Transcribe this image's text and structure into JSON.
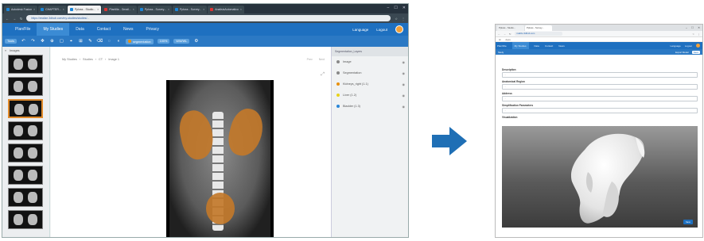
{
  "colors": {
    "brand": "#1e70c0",
    "brand_dark": "#2b79c4",
    "accent_orange": "#e8900f",
    "segmentation": "#c2782a",
    "arrow": "#1f6fb5"
  },
  "left_window": {
    "tabs": [
      {
        "label": "Autodesk Fusion",
        "active": false
      },
      {
        "label": "CHAPTER...",
        "active": false
      },
      {
        "label": "Ppluss - Studio...",
        "active": true
      },
      {
        "label": "Plantilla - Gmail...",
        "active": false
      },
      {
        "label": "Ppluss - Survey...",
        "active": false
      },
      {
        "label": "Ppluss - Survey...",
        "active": false
      },
      {
        "label": "AnalisisAutomatico",
        "active": false
      }
    ],
    "url": "https://realize.3dhub.com/my-studies/studies/...",
    "nav": {
      "items": [
        {
          "label": "Plan/File",
          "active": false
        },
        {
          "label": "My Studies",
          "active": true
        },
        {
          "label": "Data",
          "active": false
        },
        {
          "label": "Contact",
          "active": false
        },
        {
          "label": "News",
          "active": false
        },
        {
          "label": "Privacy",
          "active": false
        }
      ],
      "language": "Language",
      "logout": "Logout"
    },
    "toolbar": {
      "tool_label": "Tools",
      "layer_chip": "segmentation",
      "zoom_chip": "100%",
      "wl_chip": "WW/WL"
    },
    "thumbnails": {
      "header": "Images",
      "count": 8,
      "selected_index": 2
    },
    "viewer": {
      "breadcrumb": [
        "My Studies",
        "Studies",
        "CT",
        "Image 1"
      ],
      "tools": [
        "Prev",
        "Next"
      ]
    },
    "right_panel": {
      "header": "Segmentation_Layers",
      "layers": [
        {
          "label": "Image",
          "color": "#888888"
        },
        {
          "label": "Segmentation",
          "color": "#888888"
        },
        {
          "label": "Kidneys_right (1.1)",
          "color": "#e8900f"
        },
        {
          "label": "Liver (1.2)",
          "color": "#e8d21a"
        },
        {
          "label": "Bladder (1.3)",
          "color": "#2a86d8"
        }
      ]
    }
  },
  "right_window": {
    "tabs": [
      {
        "label": "Ppluss - Studio...",
        "active": false
      },
      {
        "label": "Ppluss - Survey...",
        "active": true
      }
    ],
    "url": "realize.3dhub.com",
    "bookmark": "Apps",
    "nav": {
      "items": [
        {
          "label": "Plan/File",
          "active": false
        },
        {
          "label": "My Studies",
          "active": true
        },
        {
          "label": "Data",
          "active": false
        },
        {
          "label": "Contact",
          "active": false
        },
        {
          "label": "News",
          "active": false
        }
      ],
      "language": "Language",
      "logout": "Logout"
    },
    "subbar": {
      "title": "Study",
      "buttons": [
        "Export Model",
        "Save"
      ]
    },
    "form": {
      "fields": [
        {
          "label": "Description",
          "value": "..."
        },
        {
          "label": "Anatomical Region",
          "value": "..."
        },
        {
          "label": "Address",
          "value": "..."
        },
        {
          "label": "Simplification Parameters",
          "value": "..."
        }
      ],
      "viewport_label": "Visualization",
      "action_button": "Save"
    }
  }
}
